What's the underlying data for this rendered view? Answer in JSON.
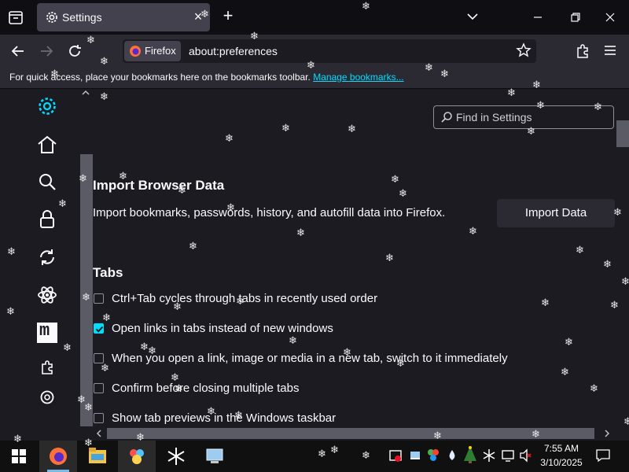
{
  "tab": {
    "title": "Settings",
    "close": "×",
    "new_tab": "+"
  },
  "urlbar": {
    "identity_label": "Firefox",
    "url": "about:preferences"
  },
  "bookmarks_bar": {
    "prompt": "For quick access, place your bookmarks here on the bookmarks toolbar.",
    "link": "Manage bookmarks..."
  },
  "sidebar": {
    "items": [
      {
        "name": "general",
        "icon": "gear-icon"
      },
      {
        "name": "home",
        "icon": "home-icon"
      },
      {
        "name": "search",
        "icon": "search-icon"
      },
      {
        "name": "privacy",
        "icon": "lock-icon"
      },
      {
        "name": "sync",
        "icon": "sync-icon"
      },
      {
        "name": "experimental",
        "icon": "atom-icon"
      },
      {
        "name": "more-from-mozilla",
        "icon": "mozilla-m-icon",
        "label": "m"
      },
      {
        "name": "extensions",
        "icon": "puzzle-icon"
      },
      {
        "name": "support",
        "icon": "help-icon"
      }
    ]
  },
  "search": {
    "placeholder": "Find in Settings"
  },
  "import": {
    "heading": "Import Browser Data",
    "description": "Import bookmarks, passwords, history, and autofill data into Firefox.",
    "button": "Import Data"
  },
  "tabs_section": {
    "heading": "Tabs",
    "options": [
      {
        "label": "Ctrl+Tab cycles through tabs in recently used order",
        "checked": false
      },
      {
        "label": "Open links in tabs instead of new windows",
        "checked": true
      },
      {
        "label": "When you open a link, image or media in a new tab, switch to it immediately",
        "checked": false
      },
      {
        "label": "Confirm before closing multiple tabs",
        "checked": false
      },
      {
        "label": "Show tab previews in the Windows taskbar",
        "checked": false
      }
    ]
  },
  "taskbar": {
    "apps": [
      "windows-start-icon",
      "firefox-icon",
      "file-explorer-icon",
      "app-icon",
      "snowflake-app-icon",
      "control-panel-icon"
    ],
    "tray_icons": [
      "security-icon",
      "battery-icon",
      "network-share-icon",
      "water-drop-icon",
      "tree-icon",
      "snowflake-icon",
      "display-icon",
      "volume-muted-icon"
    ],
    "time": "7:55 AM",
    "date": "3/10/2025"
  },
  "colors": {
    "accent": "#00ddff",
    "background": "#1c1b22",
    "toolbar": "#2b2a33"
  }
}
